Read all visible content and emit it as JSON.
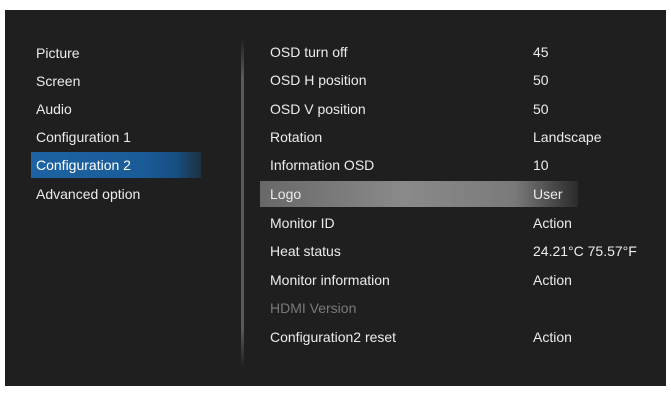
{
  "menu": {
    "items": [
      {
        "label": "Picture",
        "selected": false
      },
      {
        "label": "Screen",
        "selected": false
      },
      {
        "label": "Audio",
        "selected": false
      },
      {
        "label": "Configuration 1",
        "selected": false
      },
      {
        "label": "Configuration 2",
        "selected": true
      },
      {
        "label": "Advanced option",
        "selected": false
      }
    ]
  },
  "settings": {
    "rows": [
      {
        "label": "OSD turn off",
        "value": "45",
        "disabled": false,
        "highlighted": false
      },
      {
        "label": "OSD H position",
        "value": "50",
        "disabled": false,
        "highlighted": false
      },
      {
        "label": "OSD V position",
        "value": "50",
        "disabled": false,
        "highlighted": false
      },
      {
        "label": "Rotation",
        "value": "Landscape",
        "disabled": false,
        "highlighted": false
      },
      {
        "label": "Information OSD",
        "value": "10",
        "disabled": false,
        "highlighted": false
      },
      {
        "label": "Logo",
        "value": "User",
        "disabled": false,
        "highlighted": true
      },
      {
        "label": "Monitor ID",
        "value": "Action",
        "disabled": false,
        "highlighted": false
      },
      {
        "label": "Heat status",
        "value": "24.21°C 75.57°F",
        "disabled": false,
        "highlighted": false
      },
      {
        "label": "Monitor information",
        "value": "Action",
        "disabled": false,
        "highlighted": false
      },
      {
        "label": "HDMI Version",
        "value": "",
        "disabled": true,
        "highlighted": false
      },
      {
        "label": "Configuration2 reset",
        "value": "Action",
        "disabled": false,
        "highlighted": false
      }
    ]
  },
  "colors": {
    "selection_blue": "#1a5c98",
    "highlight_gray": "#8a8a8a",
    "panel_bg": "#1f1f1f",
    "text": "#ececec",
    "disabled_text": "#7a7a7a"
  }
}
